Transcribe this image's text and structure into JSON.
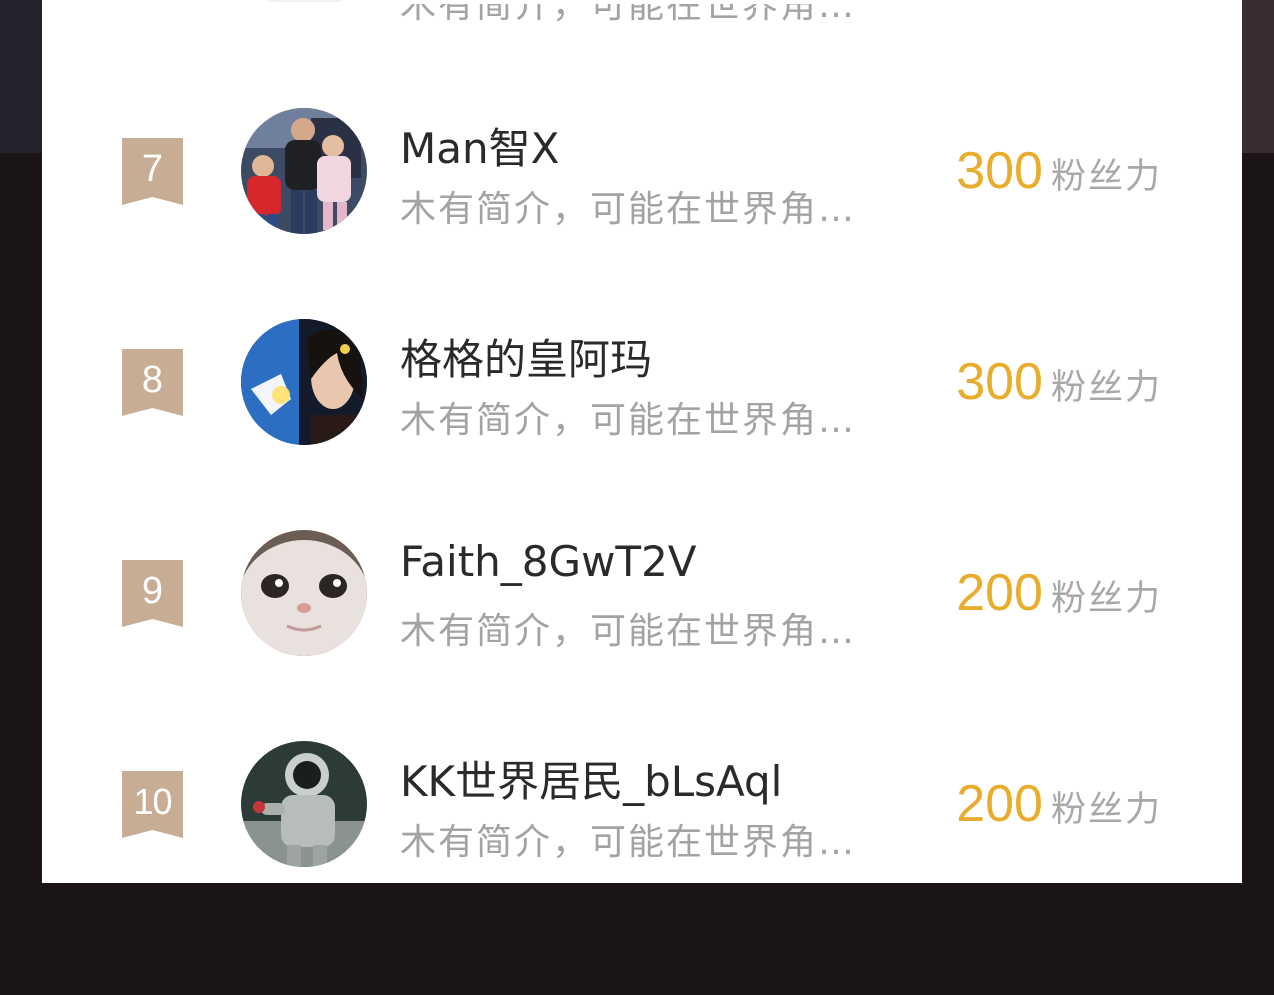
{
  "leaderboard": {
    "partial_row": {
      "bio": "木有简介，可能在世界角…"
    },
    "rows": [
      {
        "rank": "7",
        "name": "Man智X",
        "bio": "木有简介，可能在世界角…",
        "score": "300",
        "unit": "粉丝力"
      },
      {
        "rank": "8",
        "name": "格格的皇阿玛",
        "bio": "木有简介，可能在世界角…",
        "score": "300",
        "unit": "粉丝力"
      },
      {
        "rank": "9",
        "name": "Faith_8GwT2V",
        "bio": "木有简介，可能在世界角…",
        "score": "200",
        "unit": "粉丝力"
      },
      {
        "rank": "10",
        "name": "KK世界居民_bLsAql",
        "bio": "木有简介，可能在世界角…",
        "score": "200",
        "unit": "粉丝力"
      }
    ]
  },
  "colors": {
    "rank_badge": "#c7ad93",
    "score": "#e8ad2c",
    "bio": "#a3a3a3",
    "name": "#2a2a2a"
  }
}
